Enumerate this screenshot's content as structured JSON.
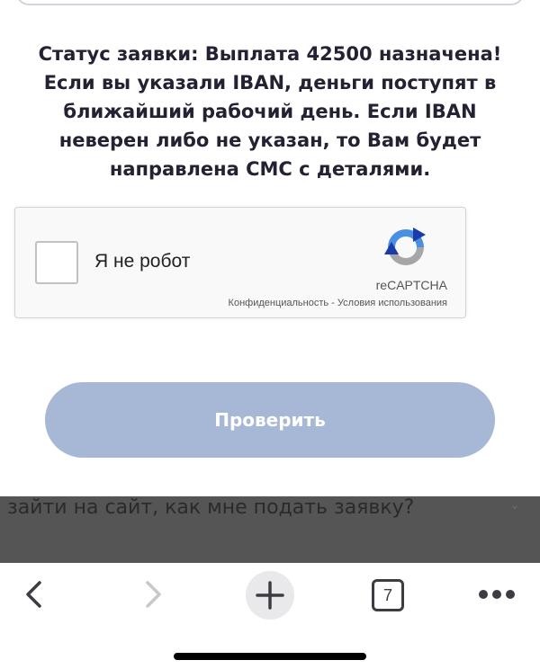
{
  "status": {
    "lines": [
      "Статус заявки: Выплата 42500 назначена!",
      "Если вы указали IBAN, деньги поступят в",
      "ближайший рабочий день. Если IBAN",
      "неверен либо не указан, то Вам будет",
      "направлена СМС с деталями."
    ]
  },
  "recaptcha": {
    "label": "Я не робот",
    "brand": "reCAPTCHA",
    "links": "Конфиденциальность - Условия использования",
    "checked": false
  },
  "button": {
    "label": "Проверить"
  },
  "suggestion": {
    "text": "зайти на сайт, как мне подать заявку?"
  },
  "toolbar": {
    "tab_count": "7"
  },
  "colors": {
    "button_bg": "#a7b7d6",
    "suggest_bg": "#555555",
    "recaptcha_blue": "#4a90e2",
    "recaptcha_gray": "#a6a6a6"
  }
}
